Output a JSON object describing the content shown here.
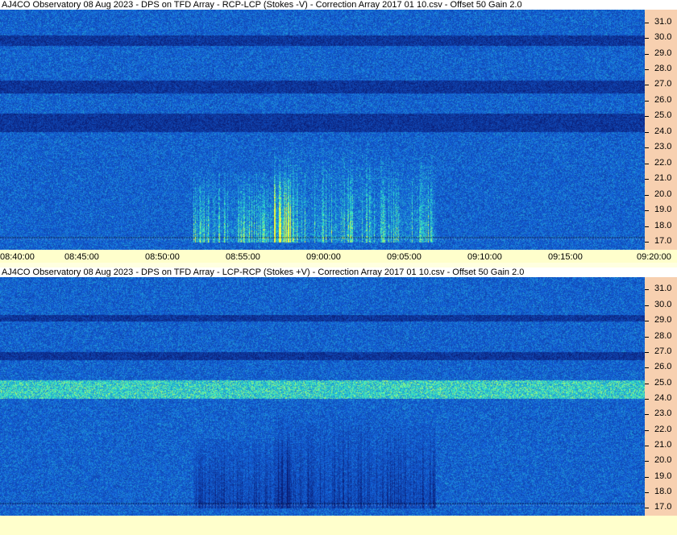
{
  "window": {
    "top_title": "AJ4CO Observatory 08 Aug 2023  -  DPS on TFD Array  -  RCP-LCP (Stokes -V)  -  Correction Array 2017 01 10.csv  -  Offset 50  Gain 2.0",
    "bottom_title": "AJ4CO Observatory 08 Aug 2023  -  DPS on TFD Array  -  LCP-RCP (Stokes +V)  -  Correction Array 2017 01 10.csv  -  Offset 50  Gain 2.0"
  },
  "colors": {
    "background_blue": "#1e5ad2",
    "dark_band": "#0a2896",
    "bright_band": "#3ce6c8",
    "axis_panel": "#f7d0b0",
    "axis_strip": "#ffffcc"
  },
  "chart_data": [
    {
      "type": "heatmap",
      "polarization": "RCP-LCP (Stokes -V)",
      "x_tick_labels": [
        "08:40:00",
        "08:45:00",
        "08:50:00",
        "08:55:00",
        "09:00:00",
        "09:05:00",
        "09:10:00",
        "09:15:00",
        "09:20:00"
      ],
      "y_tick_labels": [
        "31.0",
        "30.0",
        "29.0",
        "28.0",
        "27.0",
        "26.0",
        "25.0",
        "24.0",
        "23.0",
        "22.0",
        "21.0",
        "20.0",
        "19.0",
        "18.0",
        "17.0"
      ],
      "y_ticks": [
        31,
        30,
        29,
        28,
        27,
        26,
        25,
        24,
        23,
        22,
        21,
        20,
        19,
        18,
        17
      ],
      "xlim": [
        "08:40:00",
        "09:20:00"
      ],
      "ylim": [
        16.5,
        31.8
      ],
      "dark_bands": [
        [
          24.0,
          25.2
        ],
        [
          26.5,
          27.3
        ],
        [
          29.5,
          30.2
        ]
      ],
      "bright_bands": [],
      "burst_clusters": [
        {
          "t_start": "08:53:00",
          "t_end": "08:57:00",
          "f_low": 17.0,
          "f_high": 21.5
        },
        {
          "t_start": "08:58:00",
          "t_end": "09:02:00",
          "f_low": 17.0,
          "f_high": 23.0
        },
        {
          "t_start": "09:04:00",
          "t_end": "09:06:00",
          "f_low": 17.0,
          "f_high": 22.5
        }
      ]
    },
    {
      "type": "heatmap",
      "polarization": "LCP-RCP (Stokes +V)",
      "x_tick_labels": [],
      "y_tick_labels": [
        "31.0",
        "30.0",
        "29.0",
        "28.0",
        "27.0",
        "26.0",
        "25.0",
        "24.0",
        "23.0",
        "22.0",
        "21.0",
        "20.0",
        "19.0",
        "18.0",
        "17.0"
      ],
      "y_ticks": [
        31,
        30,
        29,
        28,
        27,
        26,
        25,
        24,
        23,
        22,
        21,
        20,
        19,
        18,
        17
      ],
      "xlim": [
        "08:40:00",
        "09:20:00"
      ],
      "ylim": [
        16.5,
        31.8
      ],
      "dark_bands": [
        [
          29.0,
          29.4
        ],
        [
          26.5,
          27.0
        ]
      ],
      "bright_bands": [
        [
          24.0,
          25.2
        ]
      ],
      "burst_clusters": [
        {
          "t_start": "08:53:00",
          "t_end": "08:57:00",
          "f_low": 17.0,
          "f_high": 21.5
        },
        {
          "t_start": "08:58:00",
          "t_end": "09:02:00",
          "f_low": 17.0,
          "f_high": 23.0
        },
        {
          "t_start": "09:04:00",
          "t_end": "09:06:00",
          "f_low": 17.0,
          "f_high": 22.5
        }
      ]
    }
  ]
}
